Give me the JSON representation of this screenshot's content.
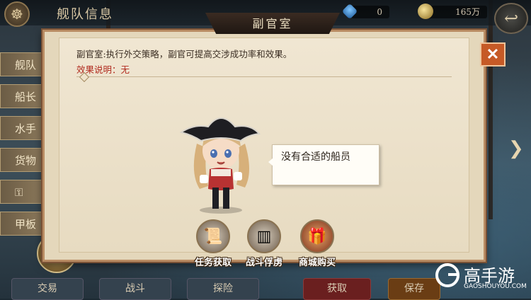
{
  "top_bar": {
    "title": "舰队信息",
    "gems": "0",
    "coins": "165万"
  },
  "left_tabs": [
    "舰队",
    "船长",
    "水手",
    "货物",
    "",
    "甲板"
  ],
  "bottom_buttons": [
    "交易",
    "战斗",
    "探险",
    "获取",
    "保存"
  ],
  "dialog": {
    "title": "副官室",
    "description": "副官室:执行外交策略，副官可提高交涉成功率和效果。",
    "effect_label": "效果说明：无",
    "speech": "没有合适的船员",
    "actions": [
      {
        "label": "任务获取",
        "icon": "scroll-quill-icon"
      },
      {
        "label": "战斗俘虏",
        "icon": "prison-cage-icon"
      },
      {
        "label": "商城购买",
        "icon": "treasure-chest-icon"
      }
    ]
  },
  "watermark": {
    "cn": "高手游",
    "en": "GAOSHOUYOU.COM"
  },
  "colors": {
    "panel": "#e4d7bb",
    "close_button": "#c65a26",
    "effect_text": "#b02a1e"
  }
}
